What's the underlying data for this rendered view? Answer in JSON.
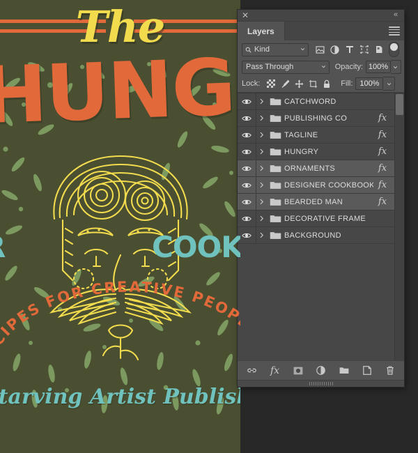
{
  "artwork": {
    "script_word": "The",
    "main_word": "HUNGRY",
    "for_word": "R",
    "cookbook_word": "COOKBOOK",
    "arc_tagline": "RECIPES FOR CREATIVE PEOPLE",
    "publisher": "Starving Artist Publishing Co.",
    "colors": {
      "background": "#4b4f32",
      "orange": "#e2693a",
      "yellow": "#f2dc4e",
      "teal": "#6fc2bd",
      "green_foliage": "#7f9e63"
    }
  },
  "panel": {
    "close_label": "✕",
    "collapse_label": "«",
    "tab_label": "Layers",
    "menu_name": "panel-menu-icon",
    "filter": {
      "kind_label": "Kind",
      "search_icon": "search-icon",
      "type_filters": [
        {
          "name": "filter-pixel-layers",
          "label": "Pixel layers"
        },
        {
          "name": "filter-adjustment-layers",
          "label": "Adjustment layers"
        },
        {
          "name": "filter-type-layers",
          "label": "Type layers"
        },
        {
          "name": "filter-shape-layers",
          "label": "Shape layers"
        },
        {
          "name": "filter-smart-objects",
          "label": "Smart objects"
        }
      ],
      "toggle_name": "filter-enable-toggle"
    },
    "blend": {
      "mode": "Pass Through",
      "opacity_label": "Opacity:",
      "opacity_value": "100%"
    },
    "lock": {
      "label": "Lock:",
      "icons": [
        {
          "name": "lock-transparent-pixels-icon",
          "label": "Lock transparent pixels"
        },
        {
          "name": "lock-image-pixels-icon",
          "label": "Lock image pixels"
        },
        {
          "name": "lock-position-icon",
          "label": "Lock position"
        },
        {
          "name": "lock-artboard-nesting-icon",
          "label": "Prevent auto-nesting"
        },
        {
          "name": "lock-all-icon",
          "label": "Lock all"
        }
      ],
      "fill_label": "Fill:",
      "fill_value": "100%"
    },
    "layers": [
      {
        "name": "CATCHWORD",
        "visible": true,
        "fx": false,
        "selected": false
      },
      {
        "name": "PUBLISHING CO",
        "visible": true,
        "fx": true,
        "selected": false
      },
      {
        "name": "TAGLINE",
        "visible": true,
        "fx": true,
        "selected": false
      },
      {
        "name": "HUNGRY",
        "visible": true,
        "fx": true,
        "selected": false
      },
      {
        "name": "ORNAMENTS",
        "visible": true,
        "fx": true,
        "selected": true
      },
      {
        "name": "DESIGNER COOKBOOK",
        "visible": true,
        "fx": true,
        "selected": true
      },
      {
        "name": "BEARDED MAN",
        "visible": true,
        "fx": true,
        "selected": true
      },
      {
        "name": "DECORATIVE FRAME",
        "visible": true,
        "fx": false,
        "selected": false
      },
      {
        "name": "BACKGROUND",
        "visible": true,
        "fx": false,
        "selected": false
      }
    ],
    "bottom_tools": [
      {
        "name": "link-layers-button",
        "label": "Link layers"
      },
      {
        "name": "add-layer-style-button",
        "label": "Add a layer style"
      },
      {
        "name": "add-layer-mask-button",
        "label": "Add layer mask"
      },
      {
        "name": "new-adjustment-layer-button",
        "label": "Create new fill or adjustment layer"
      },
      {
        "name": "new-group-button",
        "label": "Create a new group"
      },
      {
        "name": "new-layer-button",
        "label": "Create a new layer"
      },
      {
        "name": "delete-layer-button",
        "label": "Delete layer"
      }
    ]
  }
}
